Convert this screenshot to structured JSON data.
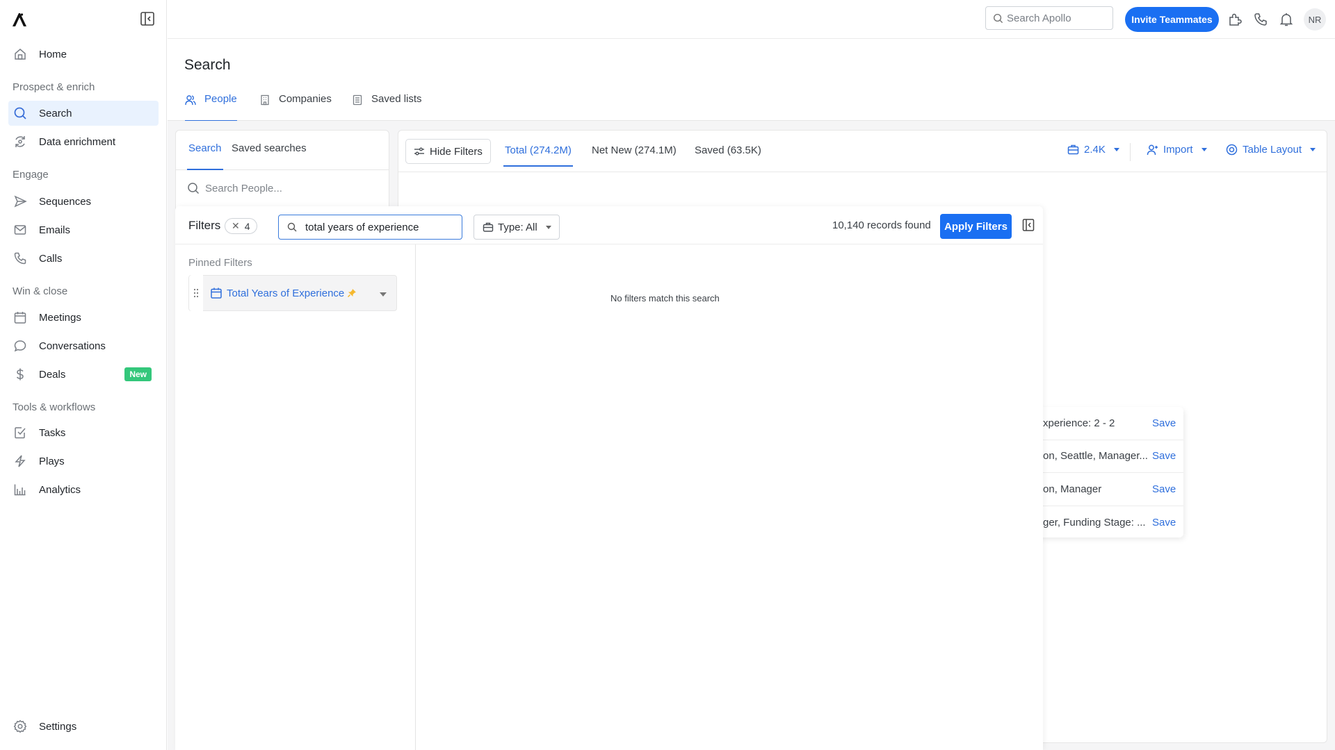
{
  "sidebar": {
    "nav_top": [
      {
        "label": "Home",
        "icon": "home-icon"
      }
    ],
    "sections": [
      {
        "title": "Prospect & enrich",
        "items": [
          {
            "label": "Search",
            "icon": "search-icon",
            "active": true
          },
          {
            "label": "Data enrichment",
            "icon": "refresh-icon"
          }
        ]
      },
      {
        "title": "Engage",
        "items": [
          {
            "label": "Sequences",
            "icon": "send-icon"
          },
          {
            "label": "Emails",
            "icon": "mail-icon"
          },
          {
            "label": "Calls",
            "icon": "phone-icon"
          }
        ]
      },
      {
        "title": "Win & close",
        "items": [
          {
            "label": "Meetings",
            "icon": "calendar-icon"
          },
          {
            "label": "Conversations",
            "icon": "chat-icon"
          },
          {
            "label": "Deals",
            "icon": "dollar-icon",
            "badge": "New"
          }
        ]
      },
      {
        "title": "Tools & workflows",
        "items": [
          {
            "label": "Tasks",
            "icon": "checkbox-icon"
          },
          {
            "label": "Plays",
            "icon": "lightning-icon"
          },
          {
            "label": "Analytics",
            "icon": "bar-chart-icon"
          }
        ]
      }
    ],
    "settings_label": "Settings",
    "badge_color": "#34c77b"
  },
  "topbar": {
    "search_placeholder": "Search Apollo",
    "invite_label": "Invite Teammates",
    "avatar_initials": "NR",
    "accent": "#1a6ff2"
  },
  "page": {
    "title": "Search",
    "tabs": [
      {
        "label": "People",
        "active": true
      },
      {
        "label": "Companies"
      },
      {
        "label": "Saved lists"
      }
    ]
  },
  "left_panel": {
    "tabs": [
      {
        "label": "Search",
        "active": true
      },
      {
        "label": "Saved searches"
      }
    ],
    "search_placeholder": "Search People..."
  },
  "results": {
    "hide_filters_label": "Hide Filters",
    "tabs": [
      {
        "label": "Total (274.2M)",
        "active": true
      },
      {
        "label": "Net New (274.1M)"
      },
      {
        "label": "Saved (63.5K)"
      }
    ],
    "credits_label": "2.4K",
    "import_label": "Import",
    "layout_label": "Table Layout"
  },
  "saved_searches": [
    {
      "text": "xperience: 2 - 2",
      "action": "Save"
    },
    {
      "text": "on, Seattle, Manager...",
      "action": "Save"
    },
    {
      "text": "on, Manager",
      "action": "Save"
    },
    {
      "text": "ger, Funding Stage: ...",
      "action": "Save"
    }
  ],
  "filters": {
    "title": "Filters",
    "active_count": "4",
    "search_value": "total years of experience",
    "type_label": "Type: All",
    "records_found": "10,140 records found",
    "apply_label": "Apply Filters",
    "pinned_label": "Pinned Filters",
    "pinned_items": [
      {
        "label": "Total Years of Experience",
        "pinned": true
      }
    ],
    "empty_message": "No filters match this search"
  }
}
